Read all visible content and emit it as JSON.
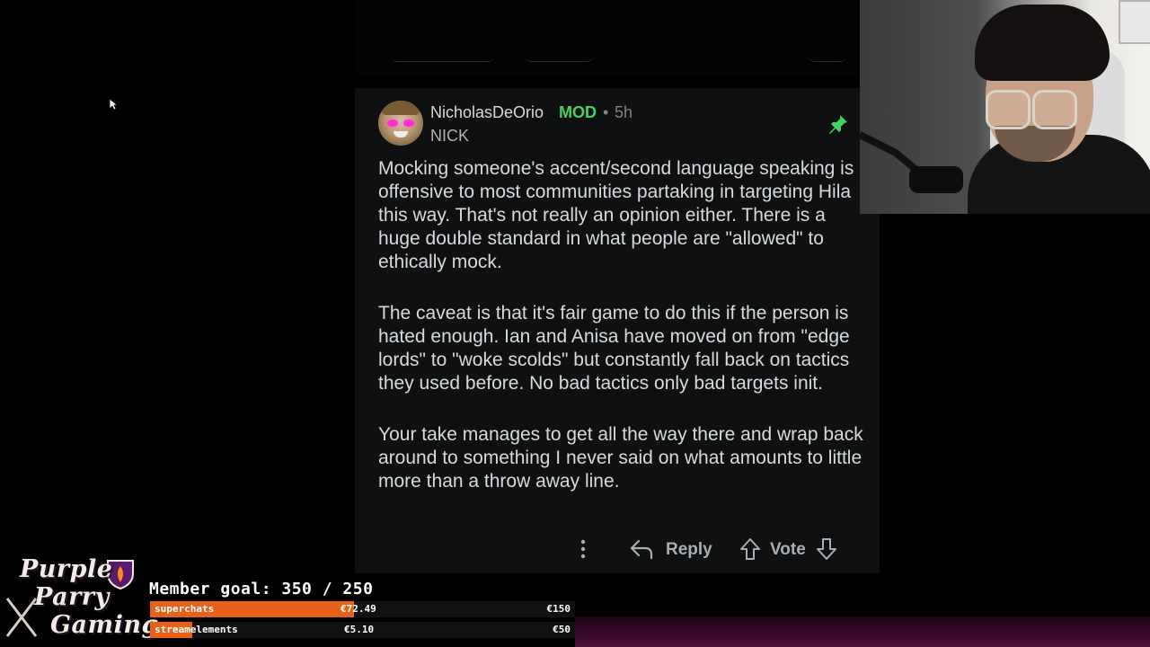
{
  "comment": {
    "username": "NicholasDeOrio",
    "mod_badge": "MOD",
    "separator": "•",
    "time": "5h",
    "flair": "NICK",
    "paragraphs": [
      "Mocking someone's accent/second language speaking is offensive to most communities partaking in targeting Hila this way. That's not really an opinion either. There is a huge double standard in what people are \"allowed\" to ethically mock.",
      "The caveat is that it's fair game to do this if the person is hated enough. Ian and Anisa have moved on from \"edge lords\" to \"woke scolds\" but constantly fall back on tactics they used before. No bad tactics only bad targets init.",
      "Your take manages to get all the way there and wrap back around to something I never said on what amounts to little more than a throw away line."
    ],
    "actions": {
      "reply_label": "Reply",
      "vote_label": "Vote"
    },
    "icons": {
      "pin": "pin-icon",
      "more": "more-options-icon",
      "reply": "reply-arrow-icon",
      "upvote": "upvote-arrow-icon",
      "downvote": "downvote-arrow-icon"
    }
  },
  "overlay": {
    "logo_lines": [
      "Purple",
      "Parry",
      "Gaming"
    ],
    "member_goal": "Member goal: 350 / 250",
    "bars": [
      {
        "label": "superchats",
        "amount": "€72.49",
        "goal": "€150",
        "progress": 0.48,
        "color": "#e8611a"
      },
      {
        "label": "streamelements",
        "amount": "€5.10",
        "goal": "€50",
        "progress": 0.1,
        "color": "#e8611a"
      }
    ]
  },
  "colors": {
    "mod_green": "#46d160",
    "pin_green": "#46d160",
    "text": "#d7dadc",
    "muted": "#818384",
    "accent_orange": "#e8611a"
  }
}
